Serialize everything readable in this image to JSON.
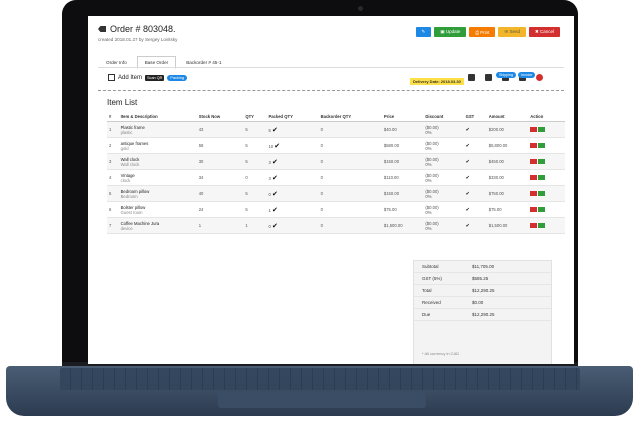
{
  "order": {
    "title": "Order # 803048.",
    "subtitle": "created 2018.01.27 by Sergey Lovitsky"
  },
  "actions": [
    {
      "label": "✎",
      "color": "#1e88e5"
    },
    {
      "label": "▣ Update",
      "color": "#2e9d3a"
    },
    {
      "label": "⎙ Print",
      "color": "#f57c00"
    },
    {
      "label": "✉ Send",
      "color": "#f3b62b"
    },
    {
      "label": "✖ Cancel",
      "color": "#d32f2f"
    }
  ],
  "tabs": [
    "Order Info",
    "Base Order",
    "Backorder # 45-1"
  ],
  "toolbar": {
    "add_item": "Add Item",
    "scan_qr": "Scan QR",
    "packing": "Packing",
    "delivery_date": "Delivery Date: 2018.03.30",
    "shipping": "Shipping",
    "invoice": "Invoice"
  },
  "list_title": "Item List",
  "columns": [
    "#",
    "Item & Description",
    "Stock Now",
    "QTY",
    "Packed QTY",
    "Backorder QTY",
    "Price",
    "Discount",
    "GST",
    "Amount",
    "Action"
  ],
  "rows": [
    {
      "n": "1",
      "name": "Plastic frame",
      "desc": "plastic",
      "stock": "43",
      "qty": "5",
      "packed": "5",
      "back": "0",
      "price": "$40.00",
      "disc": "($0.00)",
      "disc_pct": "0%",
      "amount": "$200.00"
    },
    {
      "n": "2",
      "name": "antique frames",
      "desc": "gold",
      "stock": "58",
      "qty": "5",
      "packed": "10",
      "back": "0",
      "price": "$580.00",
      "disc": "($0.00)",
      "disc_pct": "0%",
      "amount": "$5,800.00"
    },
    {
      "n": "3",
      "name": "Wall clock",
      "desc": "Wall clock",
      "stock": "30",
      "qty": "5",
      "packed": "3",
      "back": "0",
      "price": "$150.00",
      "disc": "($0.00)",
      "disc_pct": "0%",
      "amount": "$450.00"
    },
    {
      "n": "4",
      "name": "Vintage",
      "desc": "clock",
      "stock": "34",
      "qty": "0",
      "packed": "3",
      "back": "0",
      "price": "$110.00",
      "disc": "($0.00)",
      "disc_pct": "0%",
      "amount": "$330.00"
    },
    {
      "n": "5",
      "name": "Bedroom pillow",
      "desc": "Bedroom",
      "stock": "40",
      "qty": "5",
      "packed": "0",
      "back": "0",
      "price": "$150.00",
      "disc": "($0.00)",
      "disc_pct": "0%",
      "amount": "$750.00"
    },
    {
      "n": "6",
      "name": "Bolster pillow",
      "desc": "Guest room",
      "stock": "24",
      "qty": "5",
      "packed": "1",
      "back": "0",
      "price": "$75.00",
      "disc": "($0.00)",
      "disc_pct": "0%",
      "amount": "$75.00"
    },
    {
      "n": "7",
      "name": "Coffee Machine Jura",
      "desc": "device",
      "stock": "1",
      "qty": "1",
      "packed": "0",
      "back": "0",
      "price": "$1,500.00",
      "disc": "($0.00)",
      "disc_pct": "0%",
      "amount": "$1,500.00"
    }
  ],
  "summary": [
    {
      "label": "Subtotal",
      "value": "$11,705.00"
    },
    {
      "label": "GST (5%)",
      "value": "$585.25"
    },
    {
      "label": "Total",
      "value": "$12,290.25"
    },
    {
      "label": "Received",
      "value": "$0.00"
    },
    {
      "label": "Due",
      "value": "$12,290.25"
    }
  ],
  "currency_note": "* All currency in CAD"
}
